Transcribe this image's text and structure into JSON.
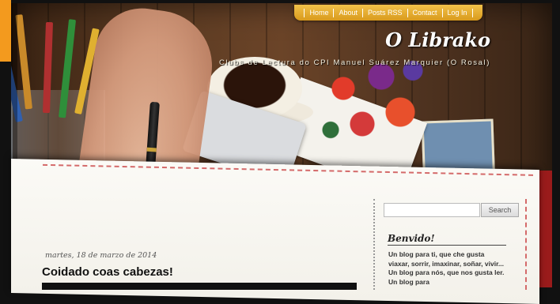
{
  "nav": {
    "items": [
      {
        "label": "Home"
      },
      {
        "label": "About"
      },
      {
        "label": "Posts RSS"
      },
      {
        "label": "Contact"
      },
      {
        "label": "Log In"
      }
    ]
  },
  "header": {
    "title": "O Librako",
    "description": "Clubs de Lectura do CPI Manuel Suárez Marquier (O Rosal)"
  },
  "post": {
    "date": "martes, 18 de marzo de 2014",
    "title": "Coidado coas cabezas!"
  },
  "sidebar": {
    "search": {
      "placeholder": "",
      "button_label": "Search"
    },
    "widget": {
      "title": "Benvido!",
      "text": "Un blog para ti, que che gusta viaxar, sorrir, imaxinar, soñar, vivir... Un blog para nós, que nos gusta ler. Un blog para"
    }
  },
  "colors": {
    "nav_bg": "#e0a628",
    "accent_tab": "#f39a1e",
    "dash": "#d46a6a"
  }
}
